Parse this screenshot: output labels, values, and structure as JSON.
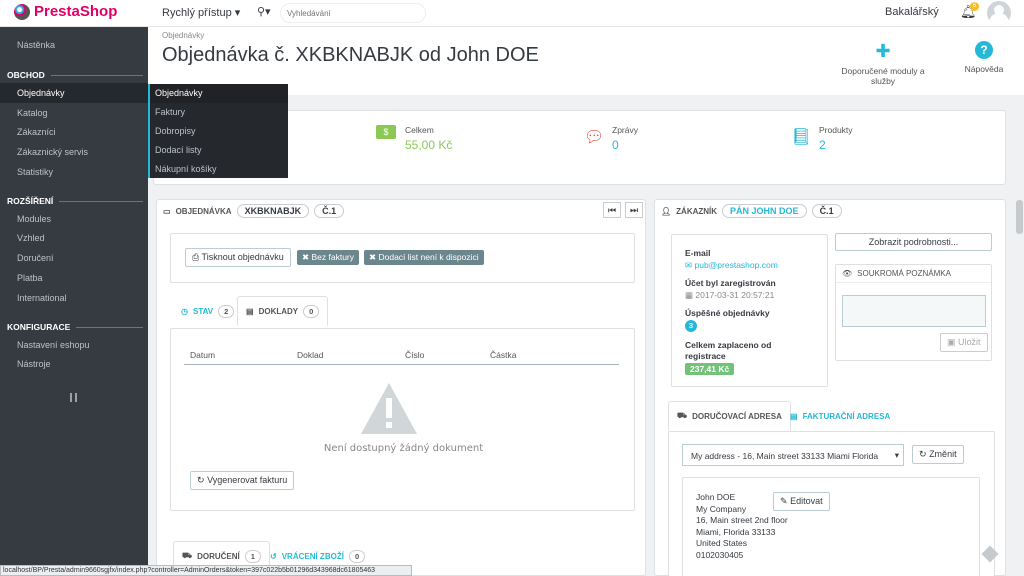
{
  "header": {
    "logo": "PrestaShop",
    "quick_access": "Rychlý přístup",
    "search_placeholder": "Vyhledávání",
    "shop_name": "Bakalářský",
    "notifications": "6"
  },
  "sidebar": {
    "dashboard": "Nástěnka",
    "sections": [
      "OBCHOD",
      "ROZŠÍŘENÍ",
      "KONFIGURACE"
    ],
    "shop_items": [
      "Objednávky",
      "Katalog",
      "Zákazníci",
      "Zákaznický servis",
      "Statistiky"
    ],
    "ext_items": [
      "Modules",
      "Vzhled",
      "Doručení",
      "Platba",
      "International"
    ],
    "conf_items": [
      "Nastavení eshopu",
      "Nástroje"
    ],
    "submenu": [
      "Objednávky",
      "Faktury",
      "Dobropisy",
      "Dodací listy",
      "Nákupní košíky"
    ]
  },
  "page": {
    "breadcrumb": "Objednávky",
    "title": "Objednávka č. XKBKNABJK od John DOE",
    "toolbar": {
      "modules": "Doporučené moduly a služby",
      "help": "Nápověda"
    }
  },
  "kpi": [
    {
      "label": "Celkem",
      "value": "55,00 Kč"
    },
    {
      "label": "Zprávy",
      "value": "0"
    },
    {
      "label": "Produkty",
      "value": "2"
    }
  ],
  "order_panel": {
    "title": "OBJEDNÁVKA",
    "reference": "XKBKNABJK",
    "number": "Č.1",
    "print_btn": "Tisknout objednávku",
    "label_no_invoice": "Bez faktury",
    "label_no_delivery": "Dodací list není k dispozici",
    "tab_status": "STAV",
    "tab_status_count": "2",
    "tab_docs": "DOKLADY",
    "tab_docs_count": "0",
    "columns": [
      "Datum",
      "Doklad",
      "Číslo",
      "Částka"
    ],
    "empty_text": "Není dostupný žádný dokument",
    "regen_btn": "Vygenerovat fakturu",
    "tab_shipping": "DORUČENÍ",
    "tab_shipping_count": "1",
    "tab_returns": "VRÁCENÍ ZBOŽÍ",
    "tab_returns_count": "0"
  },
  "customer_panel": {
    "title": "ZÁKAZNÍK",
    "name_tag": "PÁN JOHN DOE",
    "number": "Č.1",
    "email_label": "E-mail",
    "email": "pub@prestashop.com",
    "registered_label": "Účet byl zaregistrován",
    "registered": "2017-03-31 20:57:21",
    "orders_label": "Úspěšné objednávky",
    "orders": "3",
    "paid_label": "Celkem zaplaceno od registrace",
    "paid": "237,41 Kč",
    "details_btn": "Zobrazit podrobnosti...",
    "note_title": "SOUKROMÁ POZNÁMKA",
    "save_btn": "Uložit",
    "tab_delivery": "DORUČOVACÍ ADRESA",
    "tab_invoice": "FAKTURAČNÍ ADRESA",
    "address_select": "My address - 16, Main street 33133 Miami Florida",
    "change_btn": "Změnit",
    "edit_btn": "Editovat",
    "address_lines": [
      "John DOE",
      "My Company",
      "16, Main street 2nd floor",
      "Miami, Florida 33133",
      "United States",
      "0102030405"
    ]
  },
  "status_url": "localhost/BP/Presta/admin9660sgjfx/index.php?controller=AdminOrders&token=397c022b5b01296d343968dc61805463"
}
